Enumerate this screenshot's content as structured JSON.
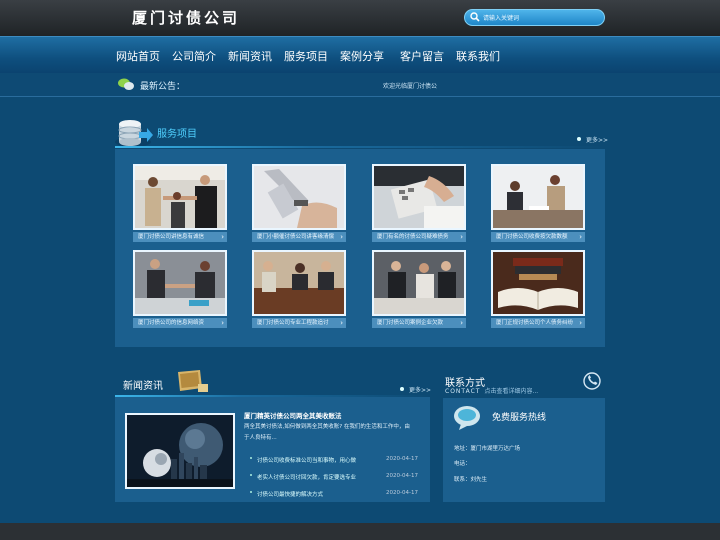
{
  "header": {
    "title": "厦门讨债公司",
    "search_placeholder": "请输入关键词"
  },
  "nav": [
    "网站首页",
    "公司简介",
    "新闻资讯",
    "服务项目",
    "案例分享",
    "客户留言",
    "联系我们"
  ],
  "notice": {
    "label": "最新公告：",
    "text": "欢迎光临厦门讨债公"
  },
  "services": {
    "title": "服务项目",
    "more": "更多>>",
    "cards": [
      {
        "caption": "厦门讨债公司讲信息有诚信"
      },
      {
        "caption": "厦门小额催讨债公司讲客缘清偿"
      },
      {
        "caption": "厦门有名的讨债公司疑难债务"
      },
      {
        "caption": "厦门讨债公司收费按欠款数额"
      },
      {
        "caption": "厦门讨债公司的信息网络资"
      },
      {
        "caption": "厦门讨债公司专业工程款追讨"
      },
      {
        "caption": "厦门讨债公司案例企业欠款"
      },
      {
        "caption": "厦门正规讨债公司个人债务纠纷"
      }
    ],
    "arrow": "›"
  },
  "news": {
    "title": "新闻资讯",
    "more": "更多>>",
    "featured_title": "厦门精英讨债公司两全其美收账法",
    "featured_body": "两全其美讨债法,如何做到两全其美收账? 在我们的生活和工作中，由于人良特有...",
    "items": [
      {
        "title": "讨债公司收费标准公司当和事物，用心做",
        "date": "2020-04-17"
      },
      {
        "title": "老实人讨债公司讨回欠款，肯定要选专业",
        "date": "2020-04-17"
      },
      {
        "title": "讨债公司最快捷的解决方式",
        "date": "2020-04-17"
      }
    ]
  },
  "contact": {
    "title": "联系方式",
    "sub_en": "CONTACT",
    "sub_note": "点击查看详细内容...",
    "hotline": "免费服务热线",
    "address": "地址：厦门市湖里万达广场",
    "phone": "电话：",
    "person": "联系：刘先生"
  }
}
